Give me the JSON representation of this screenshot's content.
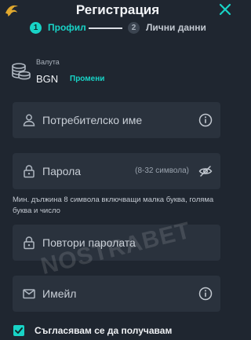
{
  "header": {
    "title": "Регистрация",
    "logo_icon": "dragon-logo-icon",
    "close_icon": "close-icon"
  },
  "stepper": {
    "steps": [
      {
        "number": "1",
        "label": "Профил",
        "active": true
      },
      {
        "number": "2",
        "label": "Лични данни",
        "active": false
      }
    ]
  },
  "currency": {
    "label": "Валута",
    "value": "BGN",
    "change_label": "Промени",
    "icon": "coins-icon"
  },
  "fields": {
    "username": {
      "placeholder": "Потребителско име",
      "icon": "user-icon",
      "right_icon": "info-icon"
    },
    "password": {
      "placeholder": "Парола",
      "hint": "(8-32 символа)",
      "icon": "lock-icon",
      "right_icon": "eye-slash-icon"
    },
    "password_helper": "Мин. дължина 8 символа включващи малка буква, голяма буква и число",
    "repeat_password": {
      "placeholder": "Повтори паролата",
      "icon": "lock-icon"
    },
    "email": {
      "placeholder": "Имейл",
      "icon": "mail-icon",
      "right_icon": "info-icon"
    }
  },
  "consent": {
    "checked": true,
    "label": "Съгласявам се да получавам"
  },
  "watermark": "NOSTRABET",
  "colors": {
    "accent": "#18d3c6",
    "background": "#1f2630",
    "field": "#2a323d"
  }
}
